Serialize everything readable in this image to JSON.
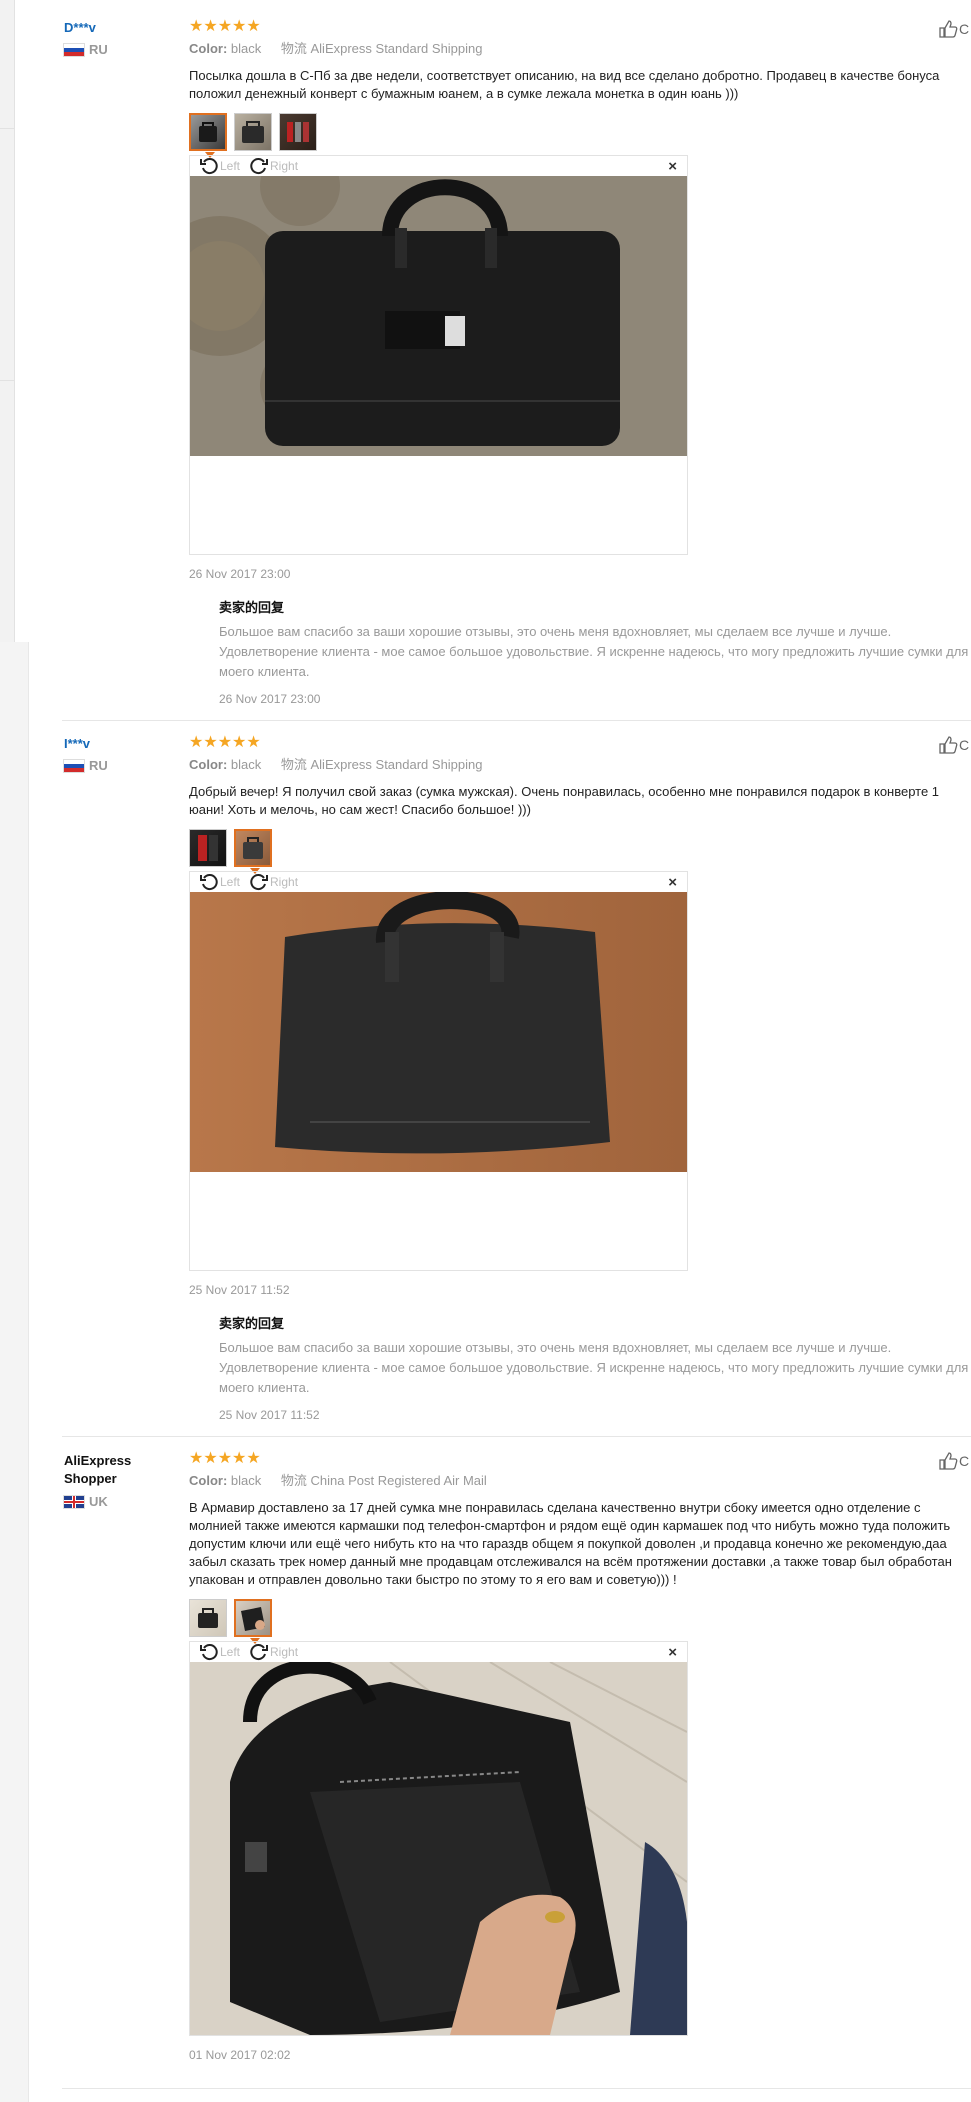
{
  "reviews": [
    {
      "user": "D***v",
      "country": "RU",
      "stars": "★★★★★",
      "color_label": "Color:",
      "color_value": "black",
      "shipping": "物流 AliExpress Standard Shipping",
      "text": "Посылка дошла в С-Пб за две недели, соответствует описанию, на вид все сделано добротно. Продавец в качестве бонуса положил денежный конверт с бумажным юанем, а в сумке лежала монетка в один юань )))",
      "viewer": {
        "left": "Left",
        "right": "Right",
        "close": "×"
      },
      "date": "26 Nov 2017 23:00",
      "reply_title": "卖家的回复",
      "reply_text": "Большое вам спасибо за ваши хорошие отзывы, это очень меня вдохновляет, мы сделаем все лучше и лучше. Удовлетворение клиента - мое самое большое удовольствие. Я искренне надеюсь, что могу предложить лучшие сумки для моего клиента.",
      "reply_date": "26 Nov 2017 23:00"
    },
    {
      "user": "I***v",
      "country": "RU",
      "stars": "★★★★★",
      "color_label": "Color:",
      "color_value": "black",
      "shipping": "物流 AliExpress Standard Shipping",
      "text": "Добрый вечер! Я получил свой заказ (сумка мужская). Очень понравилась, особенно мне понравился подарок в конверте 1 юани! Хоть и мелочь, но сам жест! Спасибо большое! )))",
      "viewer": {
        "left": "Left",
        "right": "Right",
        "close": "×"
      },
      "date": "25 Nov 2017 11:52",
      "reply_title": "卖家的回复",
      "reply_text": "Большое вам спасибо за ваши хорошие отзывы, это очень меня вдохновляет, мы сделаем все лучше и лучше. Удовлетворение клиента - мое самое большое удовольствие. Я искренне надеюсь, что могу предложить лучшие сумки для моего клиента.",
      "reply_date": "25 Nov 2017 11:52"
    },
    {
      "user": "AliExpress Shopper",
      "country": "UK",
      "stars": "★★★★★",
      "color_label": "Color:",
      "color_value": "black",
      "shipping": "物流 China Post Registered Air Mail",
      "text": "В Армавир доставлено за 17 дней сумка мне понравилась сделана качественно внутри сбоку имеется одно отделение с молнией также имеются кармашки под телефон-смартфон и рядом ещё один кармашек под что нибуть можно туда положить допустим ключи или ещё чего нибуть кто на что гараздв общем я покупкой доволен ,и продавца конечно же рекомендую,даа забыл сказать трек номер данный мне продавцам отслеживался на всём протяжении доставки ,а также товар был обработан упакован и отправлен довольно таки быстро по этому то я его вам и советую))) !",
      "viewer": {
        "left": "Left",
        "right": "Right",
        "close": "×"
      },
      "date": "01 Nov 2017 02:02"
    }
  ],
  "helpful_cut": "C",
  "icons": {
    "rotate_left": "rotate-left-icon",
    "rotate_right": "rotate-right-icon",
    "thumbs_up": "thumbs-up-icon"
  },
  "colors": {
    "star": "#f5a623",
    "username": "#1468b8",
    "active_thumb": "#e07020"
  }
}
